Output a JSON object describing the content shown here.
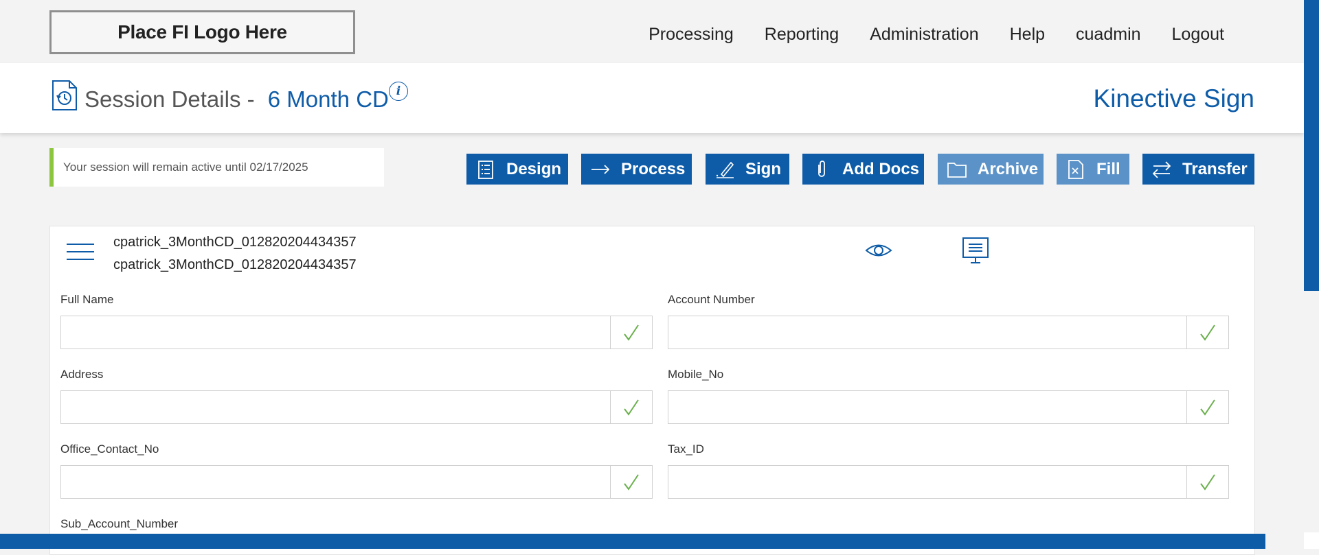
{
  "topbar": {
    "logo_text": "Place FI Logo Here",
    "nav": [
      "Processing",
      "Reporting",
      "Administration",
      "Help",
      "cuadmin",
      "Logout"
    ]
  },
  "header": {
    "title_prefix": "Session Details -",
    "session_name": "6 Month CD",
    "info_icon": "i",
    "brand": "Kinective Sign"
  },
  "notice": {
    "text": "Your session will remain active until 02/17/2025"
  },
  "toolbar": {
    "design": "Design",
    "process": "Process",
    "sign": "Sign",
    "add_docs": "Add Docs",
    "archive": "Archive",
    "fill": "Fill",
    "transfer": "Transfer"
  },
  "document": {
    "line1": "cpatrick_3MonthCD_012820204434357",
    "line2": "cpatrick_3MonthCD_012820204434357"
  },
  "fields": {
    "full_name": {
      "label": "Full Name",
      "value": ""
    },
    "account_number": {
      "label": "Account Number",
      "value": ""
    },
    "address": {
      "label": "Address",
      "value": ""
    },
    "mobile_no": {
      "label": "Mobile_No",
      "value": ""
    },
    "office_contact_no": {
      "label": "Office_Contact_No",
      "value": ""
    },
    "tax_id": {
      "label": "Tax_ID",
      "value": ""
    },
    "sub_account_number": {
      "label": "Sub_Account_Number"
    }
  },
  "colors": {
    "primary": "#0e5ca8",
    "disabled": "#5b93c9",
    "accent_green": "#8cc63f",
    "check_green": "#6ab04c"
  }
}
